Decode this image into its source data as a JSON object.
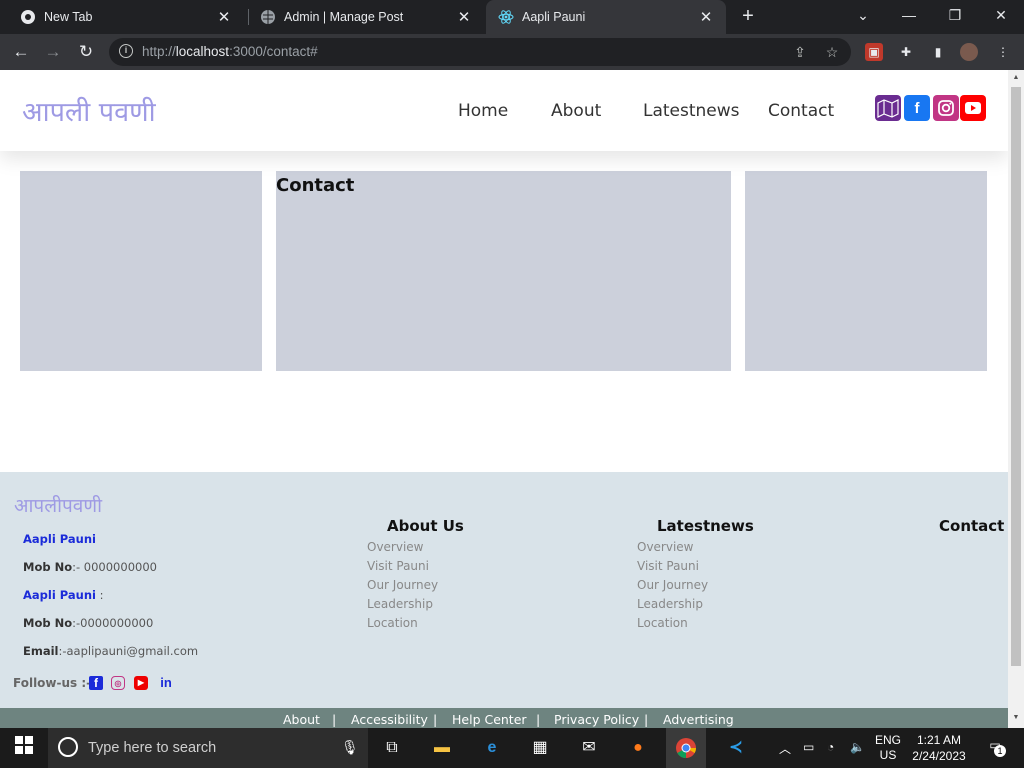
{
  "browser": {
    "tabs": [
      {
        "title": "New Tab"
      },
      {
        "title": "Admin | Manage Post"
      },
      {
        "title": "Aapli Pauni"
      }
    ],
    "url_prefix": "http://",
    "url_host": "localhost",
    "url_rest": ":3000/contact#"
  },
  "site": {
    "logo": "आपली पवणी",
    "nav": [
      "Home",
      "About",
      "Latestnews",
      "Contact"
    ],
    "social_colors": {
      "map": "#6a2c91",
      "facebook": "#1877f2",
      "instagram": "#c13584",
      "youtube": "#ff0000"
    }
  },
  "main": {
    "contact_title": "Contact"
  },
  "footer": {
    "logo": "आपलीपवणी",
    "lines": [
      {
        "key": "Aapli Pauni",
        "value": ""
      },
      {
        "key": "Mob No",
        "value": ":- 0000000000"
      },
      {
        "key": "Aapli Pauni",
        "value": " :"
      },
      {
        "key": "Mob No",
        "value": ":-0000000000"
      },
      {
        "key": "Email",
        "value": ":-aaplipauni@gmail.com"
      }
    ],
    "follow_label": "Follow-us :-",
    "about_heading": "About Us",
    "about_links": [
      "Overview",
      "Visit Pauni",
      "Our Journey",
      "Leadership",
      "Location"
    ],
    "latest_heading": "Latestnews",
    "latest_links": [
      "Overview",
      "Visit Pauni",
      "Our Journey",
      "Leadership",
      "Location"
    ],
    "contact_heading": "Contact",
    "bottom_links": [
      "About",
      "|",
      "Accessibility",
      "|",
      "Help Center",
      "|",
      "Privacy Policy",
      "|",
      "Advertising"
    ]
  },
  "taskbar": {
    "search_placeholder": "Type here to search",
    "lang_top": "ENG",
    "lang_bottom": "US",
    "time": "1:21 AM",
    "date": "2/24/2023",
    "notif_count": "1"
  }
}
